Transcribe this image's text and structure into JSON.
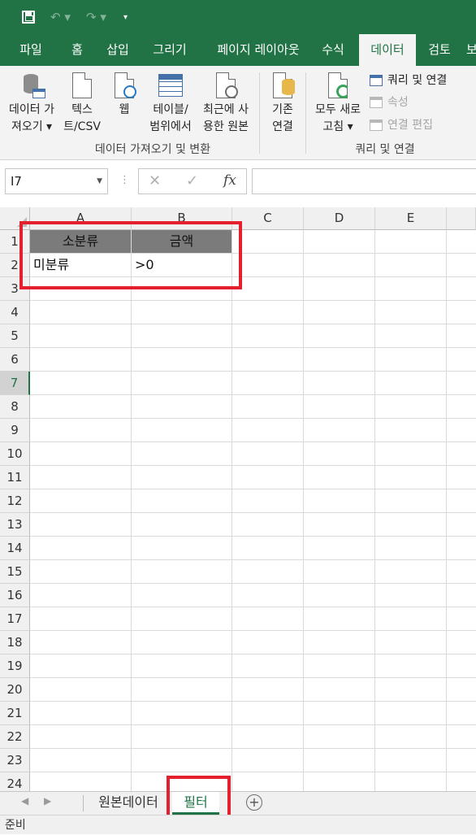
{
  "qat": {
    "save_icon": "save-icon",
    "undo_icon": "undo-icon",
    "redo_icon": "redo-icon"
  },
  "tabs": [
    "파일",
    "홈",
    "삽입",
    "그리기",
    "페이지 레이아웃",
    "수식",
    "데이터",
    "검토",
    "보"
  ],
  "active_tab": "데이터",
  "ribbon": {
    "get_data": [
      "데이터 가",
      "져오기 ▾"
    ],
    "text_csv": [
      "텍스",
      "트/CSV"
    ],
    "web": [
      "웹"
    ],
    "table_range": [
      "테이블/",
      "범위에서"
    ],
    "recent": [
      "최근에 사",
      "용한 원본"
    ],
    "existing": [
      "기존",
      "연결"
    ],
    "refresh_all": [
      "모두 새로",
      "고침 ▾"
    ],
    "queries_connections": "쿼리 및 연결",
    "properties": "속성",
    "edit_links": "연결 편집",
    "group1": "데이터 가져오기 및 변환",
    "group2": "쿼리 및 연결"
  },
  "formula_bar": {
    "name_box": "I7",
    "cancel": "✕",
    "enter": "✓",
    "fx": "fx",
    "value": ""
  },
  "columns": [
    "A",
    "B",
    "C",
    "D",
    "E"
  ],
  "rows": [
    "1",
    "2",
    "3",
    "4",
    "5",
    "6",
    "7",
    "8",
    "9",
    "10",
    "11",
    "12",
    "13",
    "14",
    "15",
    "16",
    "17",
    "18",
    "19",
    "20",
    "21",
    "22",
    "23",
    "24"
  ],
  "selected_row": "7",
  "cells": {
    "A1": "소분류",
    "B1": "금액",
    "A2": "미분류",
    "B2": ">0"
  },
  "sheets": [
    "원본데이터",
    "필터"
  ],
  "active_sheet": "필터",
  "status": "준비",
  "colors": {
    "brand": "#217346",
    "highlight": "#e5202e",
    "header_fill": "#7b7b7b"
  }
}
